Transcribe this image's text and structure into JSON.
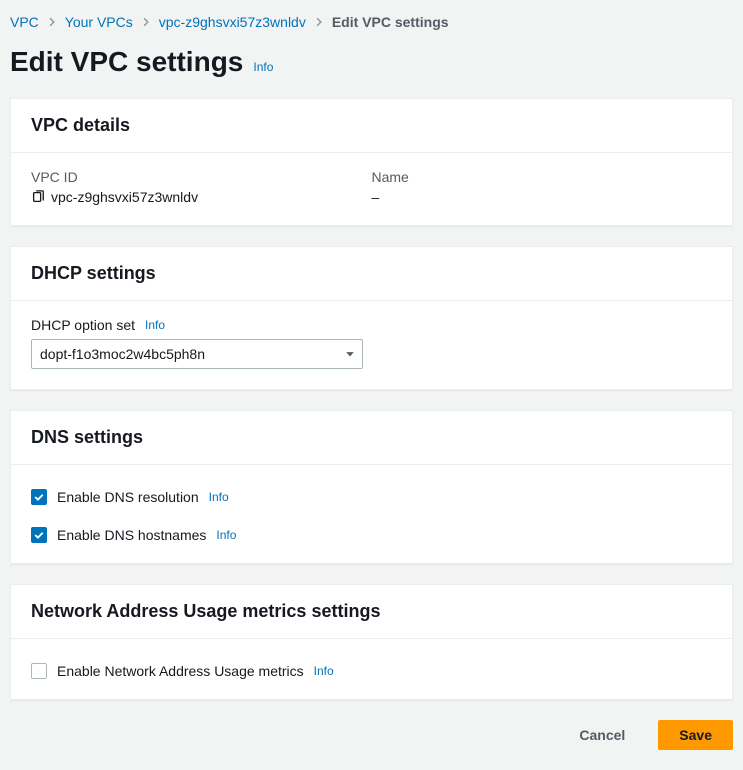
{
  "breadcrumb": {
    "items": [
      {
        "label": "VPC"
      },
      {
        "label": "Your VPCs"
      },
      {
        "label": "vpc-z9ghsvxi57z3wnldv"
      }
    ],
    "current": "Edit VPC settings"
  },
  "page": {
    "title": "Edit VPC settings",
    "info": "Info"
  },
  "vpc_details": {
    "header": "VPC details",
    "vpc_id_label": "VPC ID",
    "vpc_id_value": "vpc-z9ghsvxi57z3wnldv",
    "name_label": "Name",
    "name_value": "–"
  },
  "dhcp": {
    "header": "DHCP settings",
    "option_set_label": "DHCP option set",
    "info": "Info",
    "selected": "dopt-f1o3moc2w4bc5ph8n"
  },
  "dns": {
    "header": "DNS settings",
    "resolution_label": "Enable DNS resolution",
    "resolution_info": "Info",
    "hostnames_label": "Enable DNS hostnames",
    "hostnames_info": "Info"
  },
  "nau": {
    "header": "Network Address Usage metrics settings",
    "enable_label": "Enable Network Address Usage metrics",
    "info": "Info"
  },
  "footer": {
    "cancel": "Cancel",
    "save": "Save"
  }
}
